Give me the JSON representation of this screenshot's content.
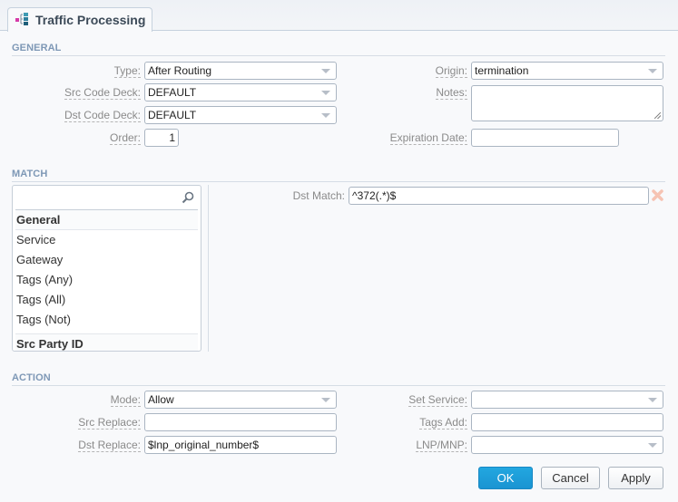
{
  "window": {
    "tab_title": "Traffic Processing",
    "tab_icon": "tree-structure-icon"
  },
  "general": {
    "section_title": "GENERAL",
    "type": {
      "label": "Type:",
      "value": "After Routing"
    },
    "src_code_deck": {
      "label": "Src Code Deck:",
      "value": "DEFAULT"
    },
    "dst_code_deck": {
      "label": "Dst Code Deck:",
      "value": "DEFAULT"
    },
    "order": {
      "label": "Order:",
      "value": "1"
    },
    "origin": {
      "label": "Origin:",
      "value": "termination"
    },
    "notes": {
      "label": "Notes:",
      "value": ""
    },
    "expiration_date": {
      "label": "Expiration Date:",
      "value": ""
    }
  },
  "match": {
    "section_title": "MATCH",
    "search": {
      "value": "",
      "icon": "search-icon"
    },
    "list": [
      {
        "label": "General",
        "type": "group"
      },
      {
        "label": "Service",
        "type": "item"
      },
      {
        "label": "Gateway",
        "type": "item"
      },
      {
        "label": "Tags (Any)",
        "type": "item"
      },
      {
        "label": "Tags (All)",
        "type": "item"
      },
      {
        "label": "Tags (Not)",
        "type": "item"
      },
      {
        "label": "Src Party ID",
        "type": "group"
      }
    ],
    "dst_match": {
      "label": "Dst Match:",
      "value": "^372(.*)$",
      "remove_icon": "delete-icon"
    }
  },
  "action": {
    "section_title": "ACTION",
    "mode": {
      "label": "Mode:",
      "value": "Allow"
    },
    "src_replace": {
      "label": "Src Replace:",
      "value": ""
    },
    "dst_replace": {
      "label": "Dst Replace:",
      "value": "$lnp_original_number$"
    },
    "set_service": {
      "label": "Set Service:",
      "value": ""
    },
    "tags_add": {
      "label": "Tags Add:",
      "value": ""
    },
    "lnp_mnp": {
      "label": "LNP/MNP:",
      "value": ""
    }
  },
  "buttons": {
    "ok": "OK",
    "cancel": "Cancel",
    "apply": "Apply"
  },
  "colors": {
    "primary_button": "#1a9ad6",
    "section_title": "#7e98b6",
    "delete_icon": "#f6c3b3"
  }
}
